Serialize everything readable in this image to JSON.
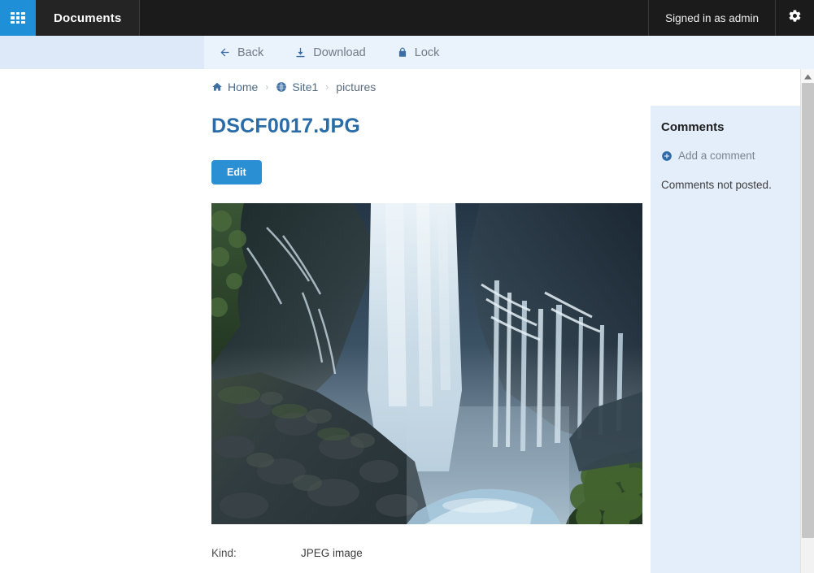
{
  "topbar": {
    "waffle_icon": "grid-apps-icon",
    "app_tab_label": "Documents",
    "signed_in_text": "Signed in as admin",
    "settings_icon": "gear-icon"
  },
  "toolbar": {
    "items": [
      {
        "label": "Back",
        "icon": "arrow-left-icon"
      },
      {
        "label": "Download",
        "icon": "download-icon"
      },
      {
        "label": "Lock",
        "icon": "lock-icon"
      }
    ]
  },
  "breadcrumb": {
    "items": [
      {
        "label": "Home",
        "icon": "home-icon"
      },
      {
        "label": "Site1",
        "icon": "globe-icon"
      },
      {
        "label": "pictures",
        "icon": ""
      }
    ],
    "separator": "›"
  },
  "document": {
    "title": "DSCF0017.JPG",
    "edit_label": "Edit",
    "preview_alt": "waterfall-photo"
  },
  "metadata": {
    "rows": [
      {
        "label": "Kind:",
        "value": "JPEG image"
      }
    ]
  },
  "comments": {
    "heading": "Comments",
    "add_label": "Add a comment",
    "add_icon": "plus-circle-icon",
    "empty_text": "Comments not posted."
  },
  "scrollbar": {
    "up_icon": "caret-up-icon"
  },
  "colors": {
    "accent_blue": "#2b8fd4",
    "waffle_blue": "#1f8fd8",
    "topbar_black": "#1b1b1b",
    "toolbar_blue": "#eaf2fb",
    "comments_blue": "#e3eefa",
    "title_blue": "#2a6ca8"
  }
}
